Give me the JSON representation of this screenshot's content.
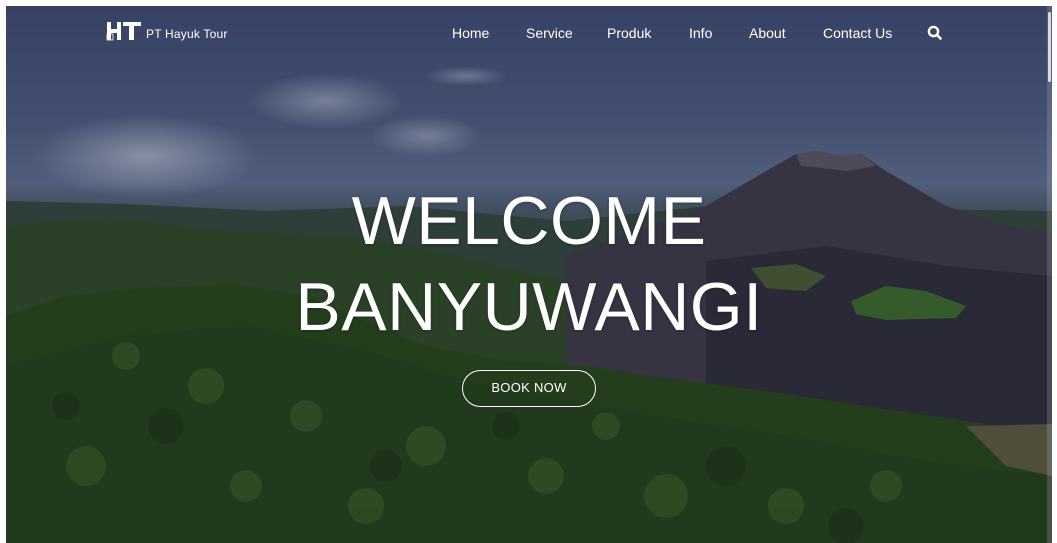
{
  "brand": {
    "name": "PT Hayuk Tour",
    "logo_icon": "ht-logo-mark"
  },
  "nav": {
    "items": [
      {
        "label": "Home"
      },
      {
        "label": "Service"
      },
      {
        "label": "Produk"
      },
      {
        "label": "Info"
      },
      {
        "label": "About"
      },
      {
        "label": "Contact Us"
      }
    ],
    "search_icon": "search-icon"
  },
  "hero": {
    "title_line1": "WELCOME",
    "title_line2": "BANYUWANGI",
    "cta_label": "BOOK NOW",
    "background": "mountain-landscape"
  },
  "colors": {
    "text": "#ffffff",
    "sky": "#4d5c80",
    "forest": "#2e4a22"
  }
}
